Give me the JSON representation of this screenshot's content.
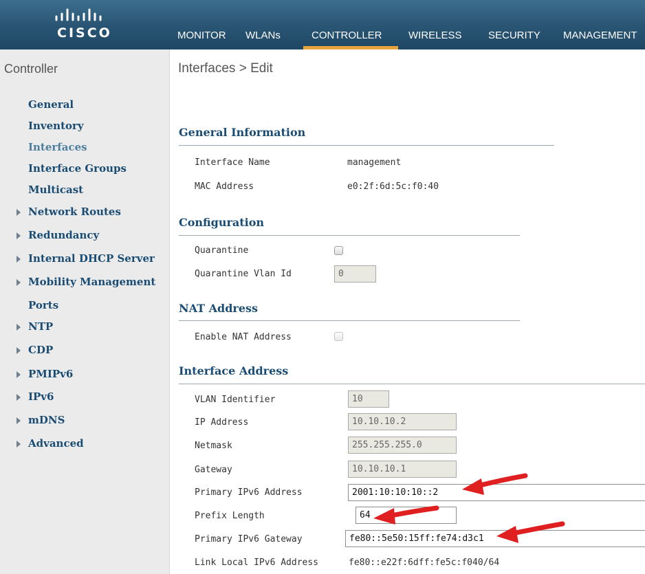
{
  "brand": {
    "logo_text": "CISCO"
  },
  "nav": [
    "MONITOR",
    "WLANs",
    "CONTROLLER",
    "WIRELESS",
    "SECURITY",
    "MANAGEMENT"
  ],
  "sidebar": {
    "title": "Controller",
    "items": [
      {
        "label": "General",
        "expandable": false,
        "current": false
      },
      {
        "label": "Inventory",
        "expandable": false,
        "current": false
      },
      {
        "label": "Interfaces",
        "expandable": false,
        "current": true
      },
      {
        "label": "Interface Groups",
        "expandable": false,
        "current": false
      },
      {
        "label": "Multicast",
        "expandable": false,
        "current": false
      },
      {
        "label": "Network Routes",
        "expandable": true,
        "current": false
      },
      {
        "label": "Redundancy",
        "expandable": true,
        "current": false
      },
      {
        "label": "Internal DHCP Server",
        "expandable": true,
        "current": false
      },
      {
        "label": "Mobility Management",
        "expandable": true,
        "current": false
      },
      {
        "label": "Ports",
        "expandable": false,
        "current": false
      },
      {
        "label": "NTP",
        "expandable": true,
        "current": false
      },
      {
        "label": "CDP",
        "expandable": true,
        "current": false
      },
      {
        "label": "PMIPv6",
        "expandable": true,
        "current": false
      },
      {
        "label": "IPv6",
        "expandable": true,
        "current": false
      },
      {
        "label": "mDNS",
        "expandable": true,
        "current": false
      },
      {
        "label": "Advanced",
        "expandable": true,
        "current": false
      }
    ]
  },
  "main": {
    "title": "Interfaces > Edit",
    "general": {
      "heading": "General Information",
      "interface_name_label": "Interface Name",
      "interface_name": "management",
      "mac_label": "MAC Address",
      "mac": "e0:2f:6d:5c:f0:40"
    },
    "configuration": {
      "heading": "Configuration",
      "quarantine_label": "Quarantine",
      "quarantine_checked": false,
      "quarantine_vlan_label": "Quarantine Vlan Id",
      "quarantine_vlan": "0"
    },
    "nat": {
      "heading": "NAT Address",
      "enable_label": "Enable NAT Address",
      "enable_checked": false
    },
    "interface_address": {
      "heading": "Interface Address",
      "vlan_label": "VLAN Identifier",
      "vlan": "10",
      "ip_label": "IP Address",
      "ip": "10.10.10.2",
      "netmask_label": "Netmask",
      "netmask": "255.255.255.0",
      "gateway_label": "Gateway",
      "gateway": "10.10.10.1",
      "ipv6_label": "Primary IPv6 Address",
      "ipv6": "2001:10:10:10::2",
      "prefix_label": "Prefix Length",
      "prefix": "64",
      "ipv6_gw_label": "Primary IPv6 Gateway",
      "ipv6_gw": "fe80::5e50:15ff:fe74:d3c1",
      "link_local_label": "Link Local IPv6 Address",
      "link_local": "fe80::e22f:6dff:fe5c:f040/64"
    }
  },
  "colors": {
    "accent": "#e8a33d",
    "header": "#2a5675",
    "link": "#1a4c73",
    "annotation_arrow": "#e02020"
  }
}
